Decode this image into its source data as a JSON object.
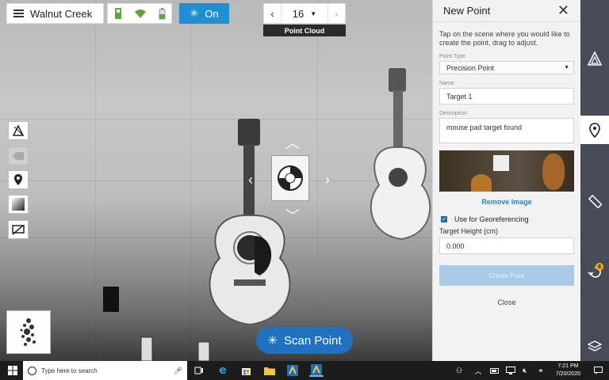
{
  "toolbar": {
    "site_name": "Walnut Creek",
    "toggle_label": "On",
    "density_value": "16",
    "point_cloud_label": "Point Cloud"
  },
  "scene": {
    "scan_button_label": "Scan Point"
  },
  "panel": {
    "title": "New Point",
    "instructions": "Tap on the scene where you would like to create the point, drag to adjust.",
    "point_type_label": "Point Type",
    "point_type_value": "Precision Point",
    "name_label": "Name",
    "name_value": "Target 1",
    "description_label": "Description",
    "description_value": "mouse pad target found",
    "remove_image_label": "Remove Image",
    "georef_label": "Use for Georeferencing",
    "georef_checked": true,
    "target_height_label": "Target Height (cm)",
    "target_height_value": "0.000",
    "create_button_label": "Create Point",
    "close_label": "Close"
  },
  "rail": {
    "badge_count": "8",
    "active_item": "point"
  },
  "taskbar": {
    "search_placeholder": "Type here to search",
    "time": "7:21 PM",
    "date": "7/20/2020"
  },
  "colors": {
    "accent": "#1e8fd0",
    "scan_button": "#1e72c0",
    "rail_bg": "#474b57",
    "badge": "#f3a81b",
    "link": "#1f88c4"
  }
}
